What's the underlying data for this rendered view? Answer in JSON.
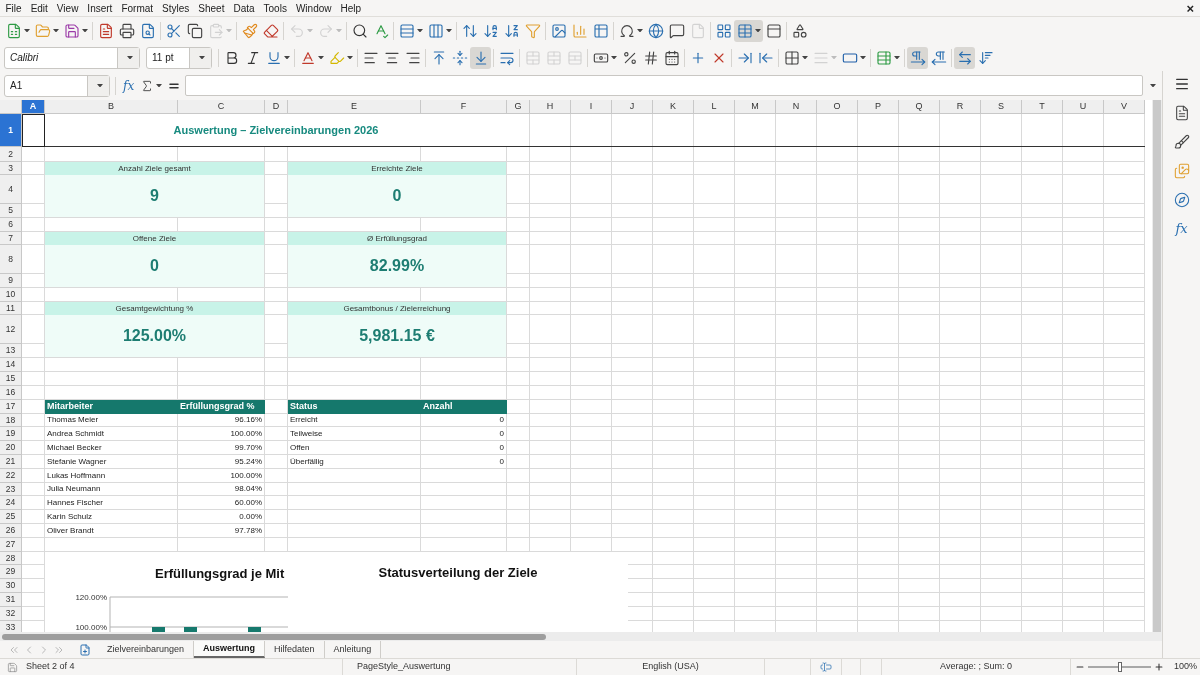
{
  "menu_bar": {
    "items": [
      "File",
      "Edit",
      "View",
      "Insert",
      "Format",
      "Styles",
      "Sheet",
      "Data",
      "Tools",
      "Window",
      "Help"
    ],
    "close": "×"
  },
  "standard_toolbar": [
    {
      "disabled": false,
      "pressed": false,
      "dropdown": true
    },
    {
      "disabled": false,
      "pressed": false,
      "dropdown": true
    },
    {
      "disabled": false,
      "pressed": false,
      "dropdown": true
    },
    {
      "disabled": false,
      "pressed": false,
      "dropdown": false
    },
    {
      "disabled": false,
      "pressed": false,
      "dropdown": false
    },
    {
      "disabled": false,
      "pressed": false,
      "dropdown": false
    },
    {
      "disabled": false,
      "pressed": false,
      "dropdown": false
    },
    {
      "disabled": false,
      "pressed": false,
      "dropdown": false
    },
    {
      "disabled": true,
      "pressed": false,
      "dropdown": true
    },
    {
      "disabled": false,
      "pressed": false,
      "dropdown": false
    },
    {
      "disabled": false,
      "pressed": false,
      "dropdown": false
    },
    {
      "disabled": true,
      "pressed": false,
      "dropdown": true
    },
    {
      "disabled": true,
      "pressed": false,
      "dropdown": true
    },
    {
      "disabled": false,
      "pressed": false,
      "dropdown": false
    },
    {
      "disabled": false,
      "pressed": false,
      "dropdown": false
    },
    {
      "disabled": false,
      "pressed": false,
      "dropdown": true
    },
    {
      "disabled": false,
      "pressed": false,
      "dropdown": true
    },
    {
      "disabled": false,
      "pressed": false,
      "dropdown": false
    },
    {
      "disabled": false,
      "pressed": false,
      "dropdown": false
    },
    {
      "disabled": false,
      "pressed": false,
      "dropdown": false
    },
    {
      "disabled": false,
      "pressed": false,
      "dropdown": false
    },
    {
      "disabled": false,
      "pressed": false,
      "dropdown": false
    },
    {
      "disabled": false,
      "pressed": false,
      "dropdown": false
    },
    {
      "disabled": false,
      "pressed": false,
      "dropdown": false
    },
    {
      "disabled": false,
      "pressed": false,
      "dropdown": true
    },
    {
      "disabled": false,
      "pressed": false,
      "dropdown": false
    },
    {
      "disabled": false,
      "pressed": false,
      "dropdown": false
    },
    {
      "disabled": true,
      "pressed": false,
      "dropdown": false
    },
    {
      "disabled": false,
      "pressed": false,
      "dropdown": false
    },
    {
      "disabled": false,
      "pressed": true,
      "dropdown": true
    },
    {
      "disabled": false,
      "pressed": false,
      "dropdown": false
    },
    {
      "disabled": false,
      "pressed": false,
      "dropdown": false
    }
  ],
  "formatting_toolbar": {
    "font_name": "Calibri",
    "font_size": "11 pt",
    "buttons": [
      {
        "disabled": false,
        "pressed": false,
        "dropdown": false
      },
      {
        "disabled": false,
        "pressed": false,
        "dropdown": false
      },
      {
        "disabled": false,
        "pressed": false,
        "dropdown": true
      },
      {
        "disabled": false,
        "pressed": false,
        "dropdown": true
      },
      {
        "disabled": false,
        "pressed": false,
        "dropdown": true
      },
      {
        "disabled": false,
        "pressed": false,
        "dropdown": false
      },
      {
        "disabled": false,
        "pressed": false,
        "dropdown": false
      },
      {
        "disabled": false,
        "pressed": false,
        "dropdown": false
      },
      {
        "disabled": false,
        "pressed": false,
        "dropdown": false
      },
      {
        "disabled": false,
        "pressed": false,
        "dropdown": false
      },
      {
        "disabled": false,
        "pressed": true,
        "dropdown": false
      },
      {
        "disabled": false,
        "pressed": false,
        "dropdown": false
      },
      {
        "disabled": true,
        "pressed": false,
        "dropdown": false
      },
      {
        "disabled": true,
        "pressed": false,
        "dropdown": false
      },
      {
        "disabled": true,
        "pressed": false,
        "dropdown": false
      },
      {
        "disabled": false,
        "pressed": false,
        "dropdown": true
      },
      {
        "disabled": false,
        "pressed": false,
        "dropdown": false
      },
      {
        "disabled": false,
        "pressed": false,
        "dropdown": false
      },
      {
        "disabled": false,
        "pressed": false,
        "dropdown": false
      },
      {
        "disabled": false,
        "pressed": false,
        "dropdown": false
      },
      {
        "disabled": false,
        "pressed": false,
        "dropdown": false
      },
      {
        "disabled": false,
        "pressed": false,
        "dropdown": false
      },
      {
        "disabled": false,
        "pressed": false,
        "dropdown": false
      },
      {
        "disabled": false,
        "pressed": false,
        "dropdown": true
      },
      {
        "disabled": true,
        "pressed": false,
        "dropdown": true
      },
      {
        "disabled": false,
        "pressed": false,
        "dropdown": true
      },
      {
        "disabled": false,
        "pressed": false,
        "dropdown": true
      },
      {
        "disabled": false,
        "pressed": true,
        "dropdown": false
      },
      {
        "disabled": false,
        "pressed": false,
        "dropdown": false
      },
      {
        "disabled": false,
        "pressed": true,
        "dropdown": false
      },
      {
        "disabled": false,
        "pressed": false,
        "dropdown": false
      }
    ]
  },
  "formula_bar": {
    "name_box": "A1",
    "function_wizard": "fx"
  },
  "sidebar": {
    "functions_deck": "fx"
  },
  "sheet": {
    "columns": [
      {
        "label": "A",
        "selected": true
      },
      {
        "label": "B",
        "selected": false
      },
      {
        "label": "C",
        "selected": false
      },
      {
        "label": "D",
        "selected": false
      },
      {
        "label": "E",
        "selected": false
      },
      {
        "label": "F",
        "selected": false
      },
      {
        "label": "G",
        "selected": false
      },
      {
        "label": "H",
        "selected": false
      },
      {
        "label": "I",
        "selected": false
      },
      {
        "label": "J",
        "selected": false
      },
      {
        "label": "K",
        "selected": false
      },
      {
        "label": "L",
        "selected": false
      },
      {
        "label": "M",
        "selected": false
      },
      {
        "label": "N",
        "selected": false
      },
      {
        "label": "O",
        "selected": false
      },
      {
        "label": "P",
        "selected": false
      },
      {
        "label": "Q",
        "selected": false
      },
      {
        "label": "R",
        "selected": false
      },
      {
        "label": "S",
        "selected": false
      },
      {
        "label": "T",
        "selected": false
      },
      {
        "label": "U",
        "selected": false
      },
      {
        "label": "V",
        "selected": false
      }
    ],
    "rows": [
      {
        "label": "1",
        "selected": true
      },
      {
        "label": "2",
        "selected": false
      },
      {
        "label": "3",
        "selected": false
      },
      {
        "label": "4",
        "selected": false
      },
      {
        "label": "5",
        "selected": false
      },
      {
        "label": "6",
        "selected": false
      },
      {
        "label": "7",
        "selected": false
      },
      {
        "label": "8",
        "selected": false
      },
      {
        "label": "9",
        "selected": false
      },
      {
        "label": "10",
        "selected": false
      },
      {
        "label": "11",
        "selected": false
      },
      {
        "label": "12",
        "selected": false
      },
      {
        "label": "13",
        "selected": false
      },
      {
        "label": "14",
        "selected": false
      },
      {
        "label": "15",
        "selected": false
      },
      {
        "label": "16",
        "selected": false
      },
      {
        "label": "17",
        "selected": false
      },
      {
        "label": "18",
        "selected": false
      },
      {
        "label": "19",
        "selected": false
      },
      {
        "label": "20",
        "selected": false
      },
      {
        "label": "21",
        "selected": false
      },
      {
        "label": "22",
        "selected": false
      },
      {
        "label": "23",
        "selected": false
      },
      {
        "label": "24",
        "selected": false
      },
      {
        "label": "25",
        "selected": false
      },
      {
        "label": "26",
        "selected": false
      },
      {
        "label": "27",
        "selected": false
      },
      {
        "label": "28",
        "selected": false
      },
      {
        "label": "29",
        "selected": false
      },
      {
        "label": "30",
        "selected": false
      },
      {
        "label": "31",
        "selected": false
      },
      {
        "label": "32",
        "selected": false
      },
      {
        "label": "33",
        "selected": false
      }
    ],
    "title": "Auswertung – Zielvereinbarungen 2026",
    "kpi_cards": [
      {
        "label": "Anzahl Ziele gesamt",
        "value": "9"
      },
      {
        "label": "Erreichte Ziele",
        "value": "0"
      },
      {
        "label": "Offene Ziele",
        "value": "0"
      },
      {
        "label": "Ø Erfüllungsgrad",
        "value": "82.99%"
      },
      {
        "label": "Gesamtgewichtung %",
        "value": "125.00%"
      },
      {
        "label": "Gesamtbonus / Zielerreichung",
        "value": "5,981.15 €"
      }
    ],
    "employee_table": {
      "columns": [
        "Mitarbeiter",
        "Erfüllungsgrad %"
      ],
      "rows": [
        [
          "Thomas Meier",
          "96.16%"
        ],
        [
          "Andrea Schmidt",
          "100.00%"
        ],
        [
          "Michael Becker",
          "99.70%"
        ],
        [
          "Stefanie Wagner",
          "95.24%"
        ],
        [
          "Lukas Hoffmann",
          "100.00%"
        ],
        [
          "Julia Neumann",
          "98.04%"
        ],
        [
          "Hannes Fischer",
          "60.00%"
        ],
        [
          "Karin Schulz",
          "0.00%"
        ],
        [
          "Oliver Brandt",
          "97.78%"
        ]
      ]
    },
    "status_table": {
      "columns": [
        "Status",
        "Anzahl"
      ],
      "rows": [
        [
          "Erreicht",
          "0"
        ],
        [
          "Teilweise",
          "0"
        ],
        [
          "Offen",
          "0"
        ],
        [
          "Überfällig",
          "0"
        ]
      ]
    },
    "charts": [
      {
        "chart_data": {
          "type": "bar",
          "title": "Erfüllungsgrad je Mit",
          "ylim": [
            0.9667,
            1.2
          ],
          "yticks": [
            {
              "value": 1.2,
              "label": "120.00%"
            },
            {
              "value": 1.0,
              "label": "100.00%"
            }
          ],
          "values": [
            null,
            1.0,
            1.0,
            null,
            1.0
          ]
        }
      },
      {
        "chart_data": {
          "type": "pie",
          "title": "Statusverteilung der Ziele"
        }
      }
    ]
  },
  "sheet_tabs": [
    {
      "label": "Zielvereinbarungen",
      "selected": false
    },
    {
      "label": "Auswertung",
      "selected": true
    },
    {
      "label": "Hilfedaten",
      "selected": false
    },
    {
      "label": "Anleitung",
      "selected": false
    }
  ],
  "status_bar": {
    "sheet": "Sheet 2 of 4",
    "page_style": "PageStyle_Auswertung",
    "language": "English (USA)",
    "summary": "Average: ; Sum: 0",
    "zoom": {
      "level": 0.5,
      "reading": "100%"
    }
  }
}
